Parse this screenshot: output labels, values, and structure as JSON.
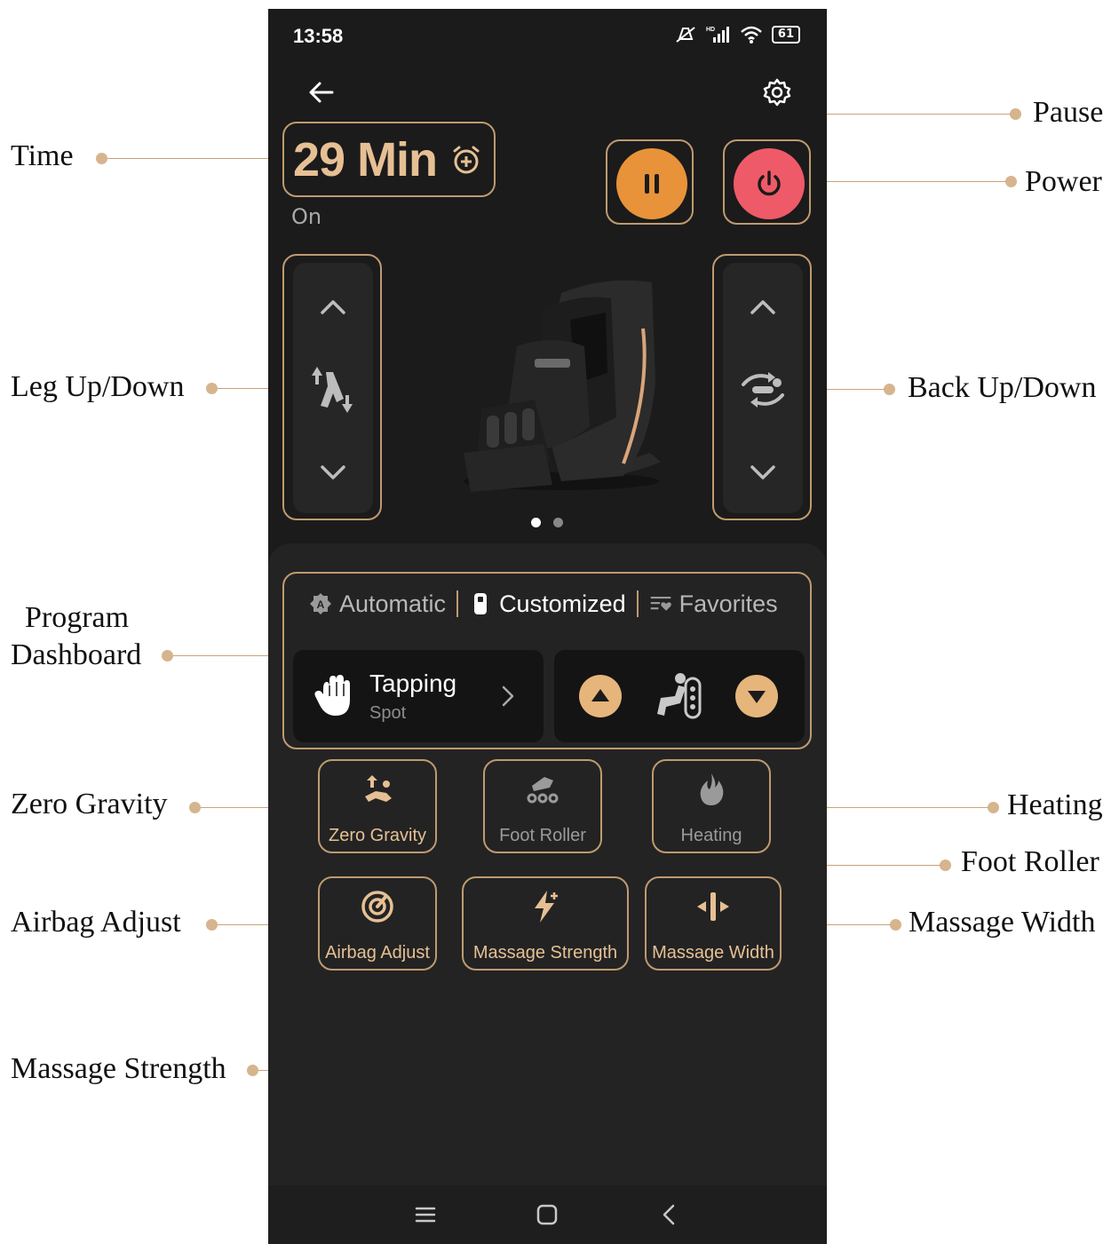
{
  "status_bar": {
    "time": "13:58",
    "battery": "61",
    "network": "HD"
  },
  "timer": {
    "value": "29 Min",
    "status": "On"
  },
  "program_tabs": [
    {
      "label": "Automatic",
      "active": false
    },
    {
      "label": "Customized",
      "active": true
    },
    {
      "label": "Favorites",
      "active": false
    }
  ],
  "current_program": {
    "name": "Tapping",
    "subtitle": "Spot"
  },
  "features": {
    "zero_gravity": "Zero Gravity",
    "foot_roller": "Foot Roller",
    "heating": "Heating",
    "airbag_adjust": "Airbag Adjust",
    "massage_strength": "Massage Strength",
    "massage_width": "Massage Width"
  },
  "callouts": {
    "time": "Time",
    "pause": "Pause",
    "power": "Power",
    "leg": "Leg Up/Down",
    "back": "Back Up/Down",
    "program_line1": "Program",
    "program_line2": "Dashboard",
    "zero_gravity": "Zero Gravity",
    "heating": "Heating",
    "foot_roller": "Foot Roller",
    "airbag_adjust": "Airbag Adjust",
    "massage_width": "Massage Width",
    "massage_strength": "Massage Strength"
  },
  "carousel": {
    "pages": 2,
    "current": 1
  },
  "colors": {
    "accent": "#e6c094",
    "pause": "#e89339",
    "power": "#ef5a68",
    "background": "#1b1b1b"
  },
  "icons": [
    "back-arrow-icon",
    "gear-icon",
    "alarm-add-icon",
    "pause-icon",
    "power-icon",
    "leg-adjust-icon",
    "back-adjust-icon",
    "hand-icon",
    "chevron-right-icon",
    "zero-gravity-icon",
    "foot-roller-icon",
    "flame-icon",
    "airbag-icon",
    "lightning-icon",
    "width-icon"
  ]
}
